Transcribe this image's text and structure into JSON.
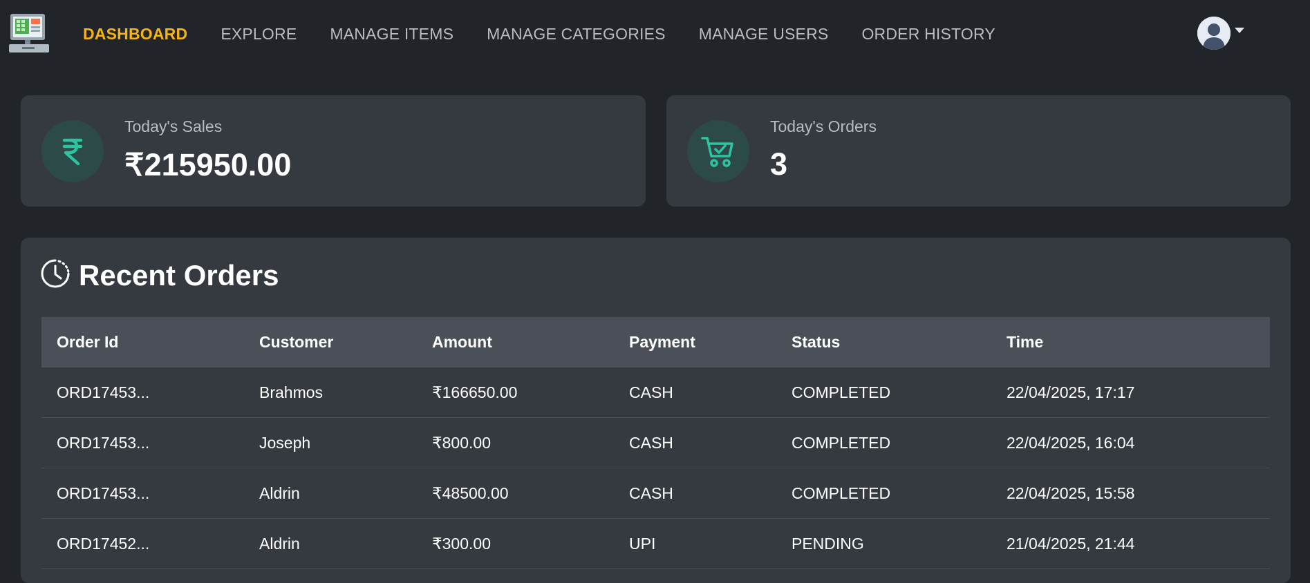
{
  "nav": {
    "items": [
      {
        "label": "DASHBOARD",
        "active": true
      },
      {
        "label": "EXPLORE",
        "active": false
      },
      {
        "label": "MANAGE ITEMS",
        "active": false
      },
      {
        "label": "MANAGE CATEGORIES",
        "active": false
      },
      {
        "label": "MANAGE USERS",
        "active": false
      },
      {
        "label": "ORDER HISTORY",
        "active": false
      }
    ],
    "active_color": "#f5b414"
  },
  "stats": {
    "sales": {
      "label": "Today's Sales",
      "value": "₹215950.00",
      "icon": "rupee-icon"
    },
    "orders": {
      "label": "Today's Orders",
      "value": "3",
      "icon": "cart-check-icon"
    }
  },
  "recent_orders": {
    "title": "Recent Orders",
    "columns": [
      "Order Id",
      "Customer",
      "Amount",
      "Payment",
      "Status",
      "Time"
    ],
    "rows": [
      [
        "ORD17453...",
        "Brahmos",
        "₹166650.00",
        "CASH",
        "COMPLETED",
        "22/04/2025, 17:17"
      ],
      [
        "ORD17453...",
        "Joseph",
        "₹800.00",
        "CASH",
        "COMPLETED",
        "22/04/2025, 16:04"
      ],
      [
        "ORD17453...",
        "Aldrin",
        "₹48500.00",
        "CASH",
        "COMPLETED",
        "22/04/2025, 15:58"
      ],
      [
        "ORD17452...",
        "Aldrin",
        "₹300.00",
        "UPI",
        "PENDING",
        "21/04/2025, 21:44"
      ]
    ]
  }
}
